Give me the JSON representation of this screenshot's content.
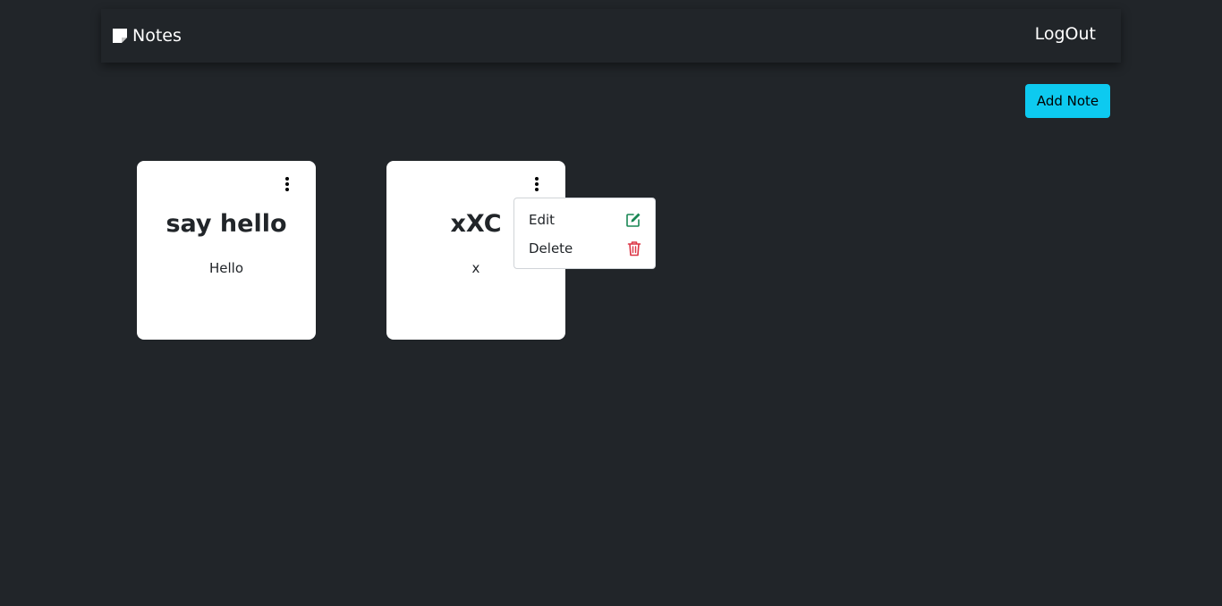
{
  "navbar": {
    "brand_label": "Notes",
    "brand_icon": "sticky-note-icon",
    "logout_label": "LogOut"
  },
  "toolbar": {
    "add_note_label": "Add Note"
  },
  "notes": [
    {
      "title": "say hello",
      "body": "Hello"
    },
    {
      "title": "xXC",
      "body": "x"
    }
  ],
  "dropdown": {
    "edit_label": "Edit",
    "edit_icon": "pencil-square-icon",
    "delete_label": "Delete",
    "delete_icon": "trash-icon"
  },
  "colors": {
    "background": "#212529",
    "accent": "#0dcaf0",
    "edit_icon": "#198754",
    "delete_icon": "#dc3545"
  }
}
